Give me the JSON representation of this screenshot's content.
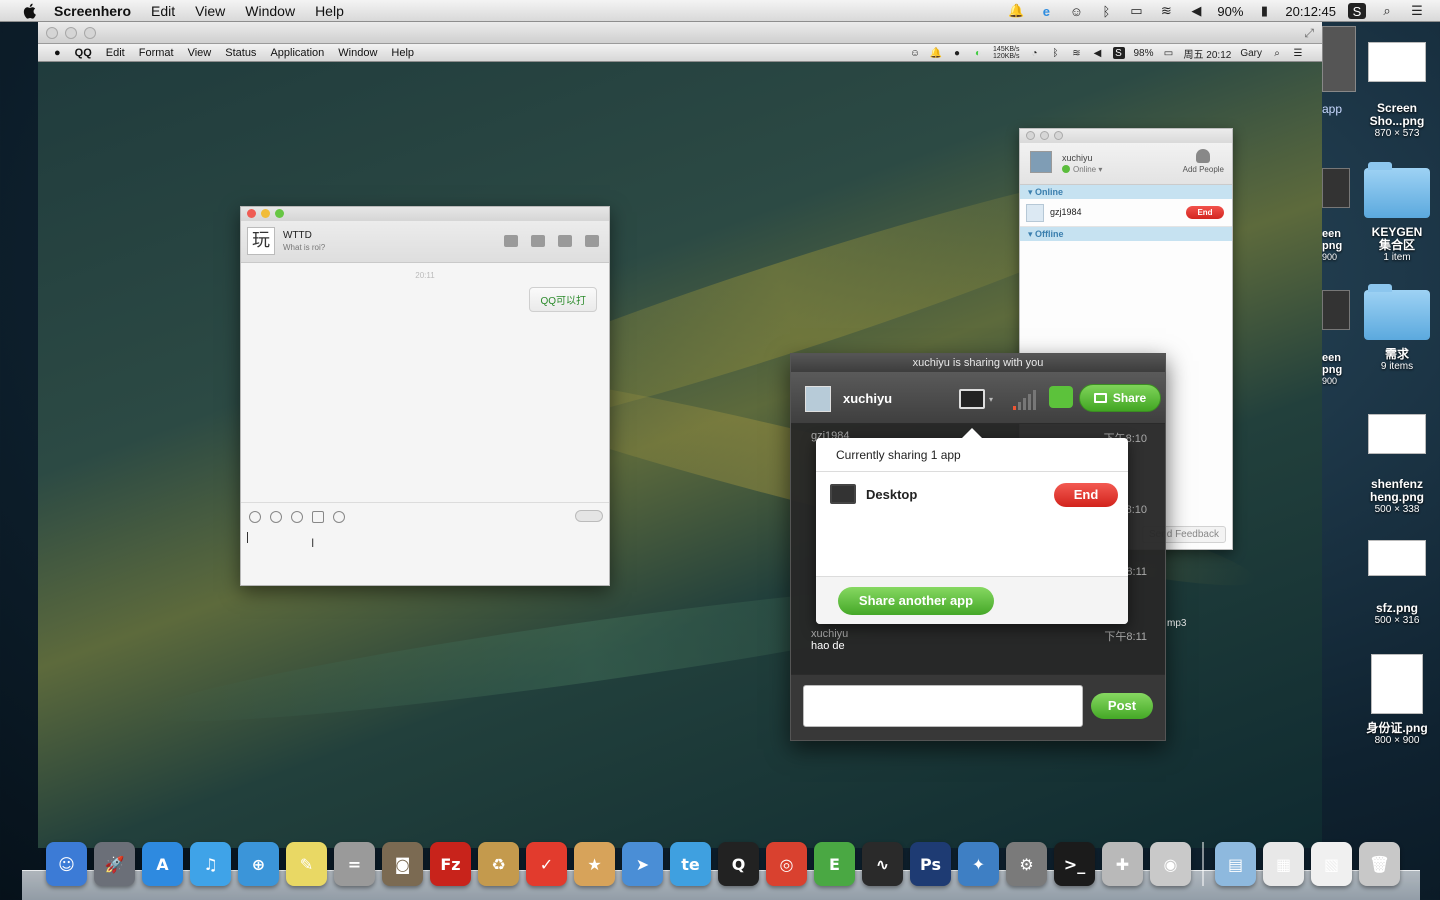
{
  "menubar": {
    "app_name": "Screenhero",
    "items": [
      "Edit",
      "View",
      "Window",
      "Help"
    ],
    "battery": "90%",
    "clock": "20:12:45"
  },
  "desktop_icons": [
    {
      "name": "Screen Sho...png",
      "meta": "870 × 573"
    },
    {
      "name": "KEYGEN\n集合区",
      "meta": "1 item"
    },
    {
      "name": "需求",
      "meta": "9 items"
    },
    {
      "name": "shenfenz heng.png",
      "meta": "500 × 338"
    },
    {
      "name": "sfz.png",
      "meta": "500 × 316"
    },
    {
      "name": "身份证.png",
      "meta": "800 × 900"
    }
  ],
  "desktop_partial": {
    "app_fragment": "app",
    "file1_line1": "een",
    "file1_line2": "png",
    "file1_meta": "900",
    "file2_line1": "een",
    "file2_line2": "png",
    "file2_meta": "900"
  },
  "guest_menubar": {
    "items": [
      "QQ",
      "Edit",
      "Format",
      "View",
      "Status",
      "Application",
      "Window",
      "Help"
    ],
    "net_up": "145KB/s",
    "net_down": "120KB/s",
    "battery": "98%",
    "clock": "周五 20:12",
    "user": "Gary"
  },
  "qq_chat": {
    "contact_name": "WTTD",
    "contact_status": "What is roi?",
    "timestamp": "20:11",
    "bubble_text": "QQ可以打",
    "avatar_char": "玩"
  },
  "sh_contacts": {
    "user_name": "xuchiyu",
    "status": "Online",
    "add_people": "Add People",
    "section_online": "Online",
    "section_offline": "Offline",
    "contacts": [
      {
        "name": "gzj1984",
        "action": "End"
      }
    ],
    "feedback": "Send Feedback"
  },
  "sh_panel": {
    "title": "xuchiyu is sharing with you",
    "user_name": "xuchiyu",
    "share_button": "Share",
    "messages": [
      {
        "who": "gzj1984",
        "text": "",
        "time": "下午8:10"
      },
      {
        "who": "",
        "text": "",
        "time": "8:10"
      },
      {
        "who": "",
        "text": "",
        "time": "8:11"
      },
      {
        "who": "xuchiyu",
        "text": "hao de",
        "time": "下午8:11"
      }
    ],
    "post_button": "Post",
    "file_fragment": "mp3"
  },
  "popover": {
    "header": "Currently sharing 1 app",
    "app_name": "Desktop",
    "end_button": "End",
    "share_another": "Share another app"
  },
  "dock": {
    "apps": [
      {
        "icon": "finder-icon",
        "glyph": "☺",
        "color": "#3c7bd6"
      },
      {
        "icon": "launchpad-icon",
        "glyph": "🚀",
        "color": "#6b6f78"
      },
      {
        "icon": "app-store-icon",
        "glyph": "A",
        "color": "#2e8ae0"
      },
      {
        "icon": "itunes-icon",
        "glyph": "♫",
        "color": "#3fa3e8"
      },
      {
        "icon": "safari-icon",
        "glyph": "⊕",
        "color": "#3b95d9"
      },
      {
        "icon": "stickies-icon",
        "glyph": "✎",
        "color": "#e9d864"
      },
      {
        "icon": "calculator-icon",
        "glyph": "=",
        "color": "#9a9a9a"
      },
      {
        "icon": "preview-icon",
        "glyph": "◙",
        "color": "#7b6a52"
      },
      {
        "icon": "filezilla-icon",
        "glyph": "Fz",
        "color": "#c8231b"
      },
      {
        "icon": "archive-utility-icon",
        "glyph": "♻",
        "color": "#c49a4d"
      },
      {
        "icon": "wunderlist-icon",
        "glyph": "✓",
        "color": "#e23b2d"
      },
      {
        "icon": "package-icon",
        "glyph": "★",
        "color": "#d7a35a"
      },
      {
        "icon": "send-icon",
        "glyph": "➤",
        "color": "#4a8ed6"
      },
      {
        "icon": "te-icon",
        "glyph": "te",
        "color": "#3fa0e0"
      },
      {
        "icon": "qq-icon",
        "glyph": "Q",
        "color": "#222"
      },
      {
        "icon": "chrome-icon",
        "glyph": "◎",
        "color": "#d9412f"
      },
      {
        "icon": "evernote-icon",
        "glyph": "E",
        "color": "#4aa843"
      },
      {
        "icon": "activity-monitor-icon",
        "glyph": "∿",
        "color": "#2a2a2a"
      },
      {
        "icon": "photoshop-icon",
        "glyph": "Ps",
        "color": "#1e3b73"
      },
      {
        "icon": "bird-icon",
        "glyph": "✦",
        "color": "#3e7fc4"
      },
      {
        "icon": "system-preferences-icon",
        "glyph": "⚙",
        "color": "#7a7a7a"
      },
      {
        "icon": "terminal-icon",
        "glyph": ">_",
        "color": "#1b1b1b"
      },
      {
        "icon": "joystick-icon",
        "glyph": "✚",
        "color": "#b9b9b9"
      },
      {
        "icon": "screenhero-icon",
        "glyph": "◉",
        "color": "#c9c9c9"
      }
    ],
    "right": [
      {
        "icon": "downloads-folder-icon",
        "glyph": "▤",
        "color": "#8eb9de"
      },
      {
        "icon": "document-stack-icon",
        "glyph": "▦",
        "color": "#e8e8e8"
      },
      {
        "icon": "document-icon",
        "glyph": "▧",
        "color": "#f0f0f0"
      },
      {
        "icon": "trash-icon",
        "glyph": "🗑",
        "color": "#c8c8c8"
      }
    ]
  }
}
